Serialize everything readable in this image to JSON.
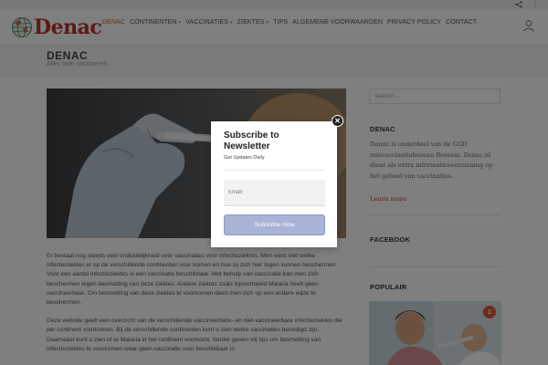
{
  "brand": {
    "logo_text": "Denac",
    "accent": "#d26622",
    "logo_color": "#b8342b"
  },
  "nav": {
    "items": [
      {
        "label": "DENAC",
        "active": true
      },
      {
        "label": "CONTINENTEN",
        "dropdown": true
      },
      {
        "label": "VACCINATIES",
        "dropdown": true
      },
      {
        "label": "ZIEKTES",
        "dropdown": true
      },
      {
        "label": "TIPS"
      },
      {
        "label": "ALGEMENE VOORWAARDEN"
      },
      {
        "label": "PRIVACY POLICY"
      },
      {
        "label": "CONTACT"
      }
    ],
    "caret": "▾"
  },
  "page": {
    "title": "DENAC",
    "subtitle": "Alles over vaccineren"
  },
  "article": {
    "paragraphs": [
      "Er bestaat nog steeds veel onduidelijkheid over vaccinaties voor infectieziektes. Men weet niet welke infectieziektes er op de verschillende continenten voor komen en hoe zij zich hier tegen kunnen beschermen. Voor een aantal infectieziektes is een vaccinatie beschikbaar. Met behulp van vaccinatie kan men zich beschermen tegen besmetting van deze ziektes. Andere ziektes zoals bijvoorbeeld Malaria heeft geen vaccineerbaar. Om besmetting van deze ziektes te voorkomen dient men zich op een andere wijze te beschermen.",
      "Deze website geeft een overzicht van de verschillende vaccineerbare- en niet-vaccineerbare infectieziektes die per continent voorkomen. Bij de verschillende continenten kunt u zien welke vaccinaties benodigd zijn. Daarnaast kunt u zien of er Malaria in het continent voorkomt. Verder geven wij tips om besmetting van infectieziektes te voorkomen waar geen vaccinatie voor beschikbaar is."
    ]
  },
  "sidebar": {
    "search_placeholder": "Search ...",
    "denac_heading": "DENAC",
    "denac_text": "Denac is onderdeel van de GGD reisvaccinatiebureau Bossum. Denac.nl dient als extra informatievoorziening op het gebied van vaccinaties.",
    "learn_more": "Learn more",
    "facebook_heading": "FACEBOOK",
    "popular_heading": "POPULAIR",
    "popular_badge": "1"
  },
  "modal": {
    "title": "Subscribe to Newsletter",
    "subtitle": "Get Updates Daily",
    "email_placeholder": "Email",
    "button_label": "Subscribe Now",
    "close_glyph": "✕"
  }
}
